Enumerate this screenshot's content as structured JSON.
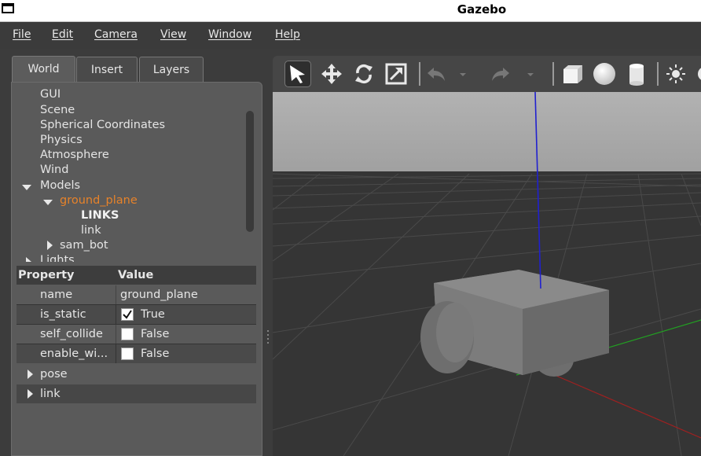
{
  "window": {
    "title": "Gazebo"
  },
  "menu": [
    "File",
    "Edit",
    "Camera",
    "View",
    "Window",
    "Help"
  ],
  "tabs": [
    "World",
    "Insert",
    "Layers"
  ],
  "tree": {
    "items": [
      "GUI",
      "Scene",
      "Spherical Coordinates",
      "Physics",
      "Atmosphere",
      "Wind"
    ],
    "models_label": "Models",
    "selected_model": "ground_plane",
    "links_header": "LINKS",
    "link_item": "link",
    "other_model": "sam_bot",
    "lights_label": "Lights"
  },
  "properties": {
    "header": {
      "property": "Property",
      "value": "Value"
    },
    "rows": [
      {
        "name": "name",
        "value": "ground_plane"
      },
      {
        "name": "is_static",
        "value": "True",
        "checked": true
      },
      {
        "name": "self_collide",
        "value": "False",
        "checked": false
      },
      {
        "name": "enable_wi...",
        "value": "False",
        "checked": false
      }
    ],
    "groups": [
      "pose",
      "link"
    ]
  },
  "colors": {
    "selected_model": "#e6822a",
    "z_axis": "#2020d0",
    "y_axis": "#20b020",
    "x_axis": "#b02020",
    "ground": "#353535",
    "sky": "#a8a8a8"
  }
}
